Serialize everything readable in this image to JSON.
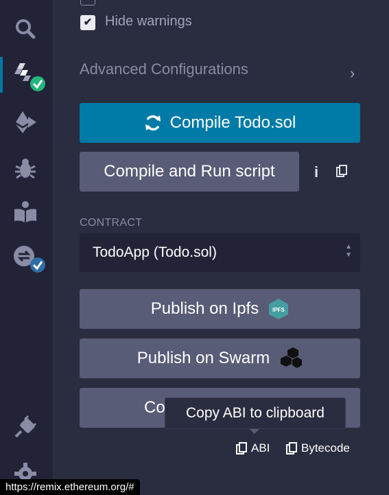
{
  "compiler": {
    "hide_warnings_label": "Hide warnings",
    "hide_warnings_checked": true,
    "advanced_label": "Advanced Configurations",
    "compile_button": "Compile Todo.sol",
    "compile_run_button": "Compile and Run script"
  },
  "contract": {
    "section_label": "CONTRACT",
    "selected": "TodoApp (Todo.sol)",
    "publish_ipfs": "Publish on Ipfs",
    "publish_ipfs_badge": "IPFS",
    "publish_swarm": "Publish on Swarm",
    "details_button_partial": "Co",
    "tooltip": "Copy ABI to clipboard",
    "abi_label": "ABI",
    "bytecode_label": "Bytecode"
  },
  "statusbar": {
    "url": "https://remix.ethereum.org/#"
  },
  "colors": {
    "accent": "#007aa6",
    "success": "#24b47e",
    "secondary": "#595c76"
  }
}
